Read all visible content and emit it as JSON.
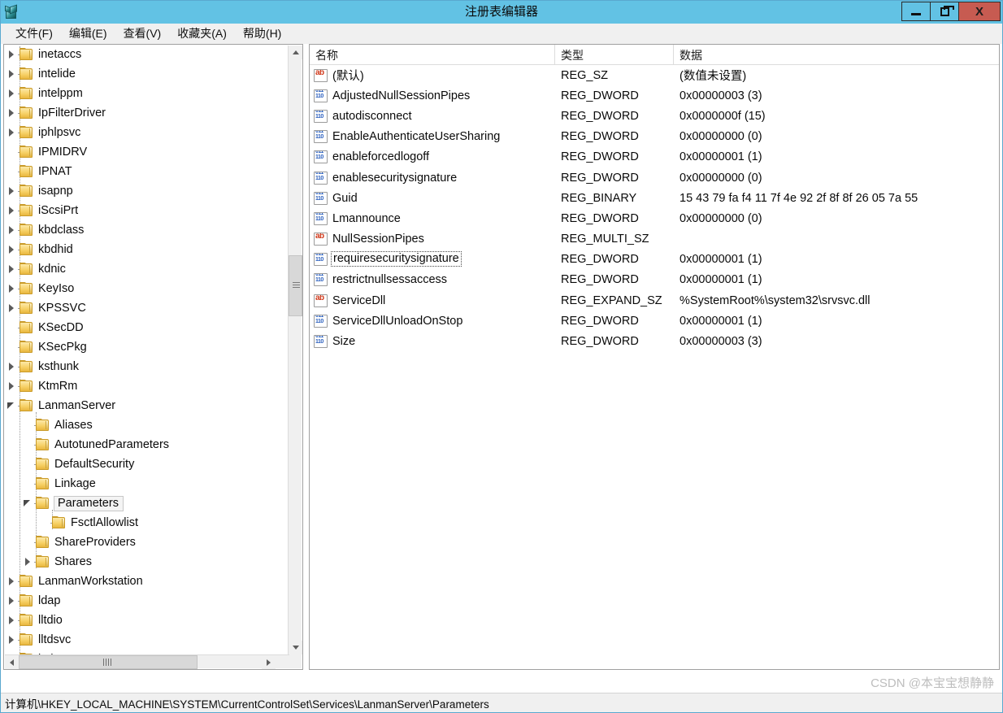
{
  "window": {
    "title": "注册表编辑器",
    "icon": "regedit-icon",
    "minimize_label": "",
    "maximize_label": "",
    "close_label": "X",
    "titlebar_color": "#62c2e4",
    "close_color": "#c75b51"
  },
  "menu": {
    "items": [
      {
        "label": "文件(F)",
        "name": "menu-file"
      },
      {
        "label": "编辑(E)",
        "name": "menu-edit"
      },
      {
        "label": "查看(V)",
        "name": "menu-view"
      },
      {
        "label": "收藏夹(A)",
        "name": "menu-favorites"
      },
      {
        "label": "帮助(H)",
        "name": "menu-help"
      }
    ]
  },
  "tree": {
    "nodes": [
      {
        "label": "inetaccs",
        "depth": 1,
        "state": "collapsed"
      },
      {
        "label": "intelide",
        "depth": 1,
        "state": "collapsed"
      },
      {
        "label": "intelppm",
        "depth": 1,
        "state": "collapsed"
      },
      {
        "label": "IpFilterDriver",
        "depth": 1,
        "state": "collapsed"
      },
      {
        "label": "iphlpsvc",
        "depth": 1,
        "state": "collapsed"
      },
      {
        "label": "IPMIDRV",
        "depth": 1,
        "state": "leaf"
      },
      {
        "label": "IPNAT",
        "depth": 1,
        "state": "leaf"
      },
      {
        "label": "isapnp",
        "depth": 1,
        "state": "collapsed"
      },
      {
        "label": "iScsiPrt",
        "depth": 1,
        "state": "collapsed"
      },
      {
        "label": "kbdclass",
        "depth": 1,
        "state": "collapsed"
      },
      {
        "label": "kbdhid",
        "depth": 1,
        "state": "collapsed"
      },
      {
        "label": "kdnic",
        "depth": 1,
        "state": "collapsed"
      },
      {
        "label": "KeyIso",
        "depth": 1,
        "state": "collapsed"
      },
      {
        "label": "KPSSVC",
        "depth": 1,
        "state": "collapsed"
      },
      {
        "label": "KSecDD",
        "depth": 1,
        "state": "leaf"
      },
      {
        "label": "KSecPkg",
        "depth": 1,
        "state": "leaf"
      },
      {
        "label": "ksthunk",
        "depth": 1,
        "state": "collapsed"
      },
      {
        "label": "KtmRm",
        "depth": 1,
        "state": "collapsed"
      },
      {
        "label": "LanmanServer",
        "depth": 1,
        "state": "expanded"
      },
      {
        "label": "Aliases",
        "depth": 2,
        "state": "leaf"
      },
      {
        "label": "AutotunedParameters",
        "depth": 2,
        "state": "leaf"
      },
      {
        "label": "DefaultSecurity",
        "depth": 2,
        "state": "leaf"
      },
      {
        "label": "Linkage",
        "depth": 2,
        "state": "leaf"
      },
      {
        "label": "Parameters",
        "depth": 2,
        "state": "expanded",
        "selected": true
      },
      {
        "label": "FsctlAllowlist",
        "depth": 3,
        "state": "leaf"
      },
      {
        "label": "ShareProviders",
        "depth": 2,
        "state": "leaf"
      },
      {
        "label": "Shares",
        "depth": 2,
        "state": "collapsed"
      },
      {
        "label": "LanmanWorkstation",
        "depth": 1,
        "state": "collapsed"
      },
      {
        "label": "ldap",
        "depth": 1,
        "state": "collapsed"
      },
      {
        "label": "lltdio",
        "depth": 1,
        "state": "collapsed"
      },
      {
        "label": "lltdsvc",
        "depth": 1,
        "state": "collapsed"
      },
      {
        "label": "lmhosts",
        "depth": 1,
        "state": "collapsed"
      }
    ]
  },
  "list": {
    "columns": [
      {
        "label": "名称",
        "name": "column-name"
      },
      {
        "label": "类型",
        "name": "column-type"
      },
      {
        "label": "数据",
        "name": "column-data"
      }
    ],
    "rows": [
      {
        "name": "(默认)",
        "type": "REG_SZ",
        "data": "(数值未设置)",
        "icon": "string-value-icon"
      },
      {
        "name": "AdjustedNullSessionPipes",
        "type": "REG_DWORD",
        "data": "0x00000003 (3)",
        "icon": "dword-value-icon"
      },
      {
        "name": "autodisconnect",
        "type": "REG_DWORD",
        "data": "0x0000000f (15)",
        "icon": "dword-value-icon"
      },
      {
        "name": "EnableAuthenticateUserSharing",
        "type": "REG_DWORD",
        "data": "0x00000000 (0)",
        "icon": "dword-value-icon"
      },
      {
        "name": "enableforcedlogoff",
        "type": "REG_DWORD",
        "data": "0x00000001 (1)",
        "icon": "dword-value-icon"
      },
      {
        "name": "enablesecuritysignature",
        "type": "REG_DWORD",
        "data": "0x00000000 (0)",
        "icon": "dword-value-icon"
      },
      {
        "name": "Guid",
        "type": "REG_BINARY",
        "data": "15 43 79 fa f4 11 7f 4e 92 2f 8f 8f 26 05 7a 55",
        "icon": "dword-value-icon"
      },
      {
        "name": "Lmannounce",
        "type": "REG_DWORD",
        "data": "0x00000000 (0)",
        "icon": "dword-value-icon"
      },
      {
        "name": "NullSessionPipes",
        "type": "REG_MULTI_SZ",
        "data": "",
        "icon": "string-value-icon"
      },
      {
        "name": "requiresecuritysignature",
        "type": "REG_DWORD",
        "data": "0x00000001 (1)",
        "icon": "dword-value-icon",
        "focused": true
      },
      {
        "name": "restrictnullsessaccess",
        "type": "REG_DWORD",
        "data": "0x00000001 (1)",
        "icon": "dword-value-icon"
      },
      {
        "name": "ServiceDll",
        "type": "REG_EXPAND_SZ",
        "data": "%SystemRoot%\\system32\\srvsvc.dll",
        "icon": "string-value-icon"
      },
      {
        "name": "ServiceDllUnloadOnStop",
        "type": "REG_DWORD",
        "data": "0x00000001 (1)",
        "icon": "dword-value-icon"
      },
      {
        "name": "Size",
        "type": "REG_DWORD",
        "data": "0x00000003 (3)",
        "icon": "dword-value-icon"
      }
    ]
  },
  "statusbar": {
    "path": "计算机\\HKEY_LOCAL_MACHINE\\SYSTEM\\CurrentControlSet\\Services\\LanmanServer\\Parameters"
  },
  "watermark": {
    "text": "CSDN @本宝宝想静静"
  }
}
